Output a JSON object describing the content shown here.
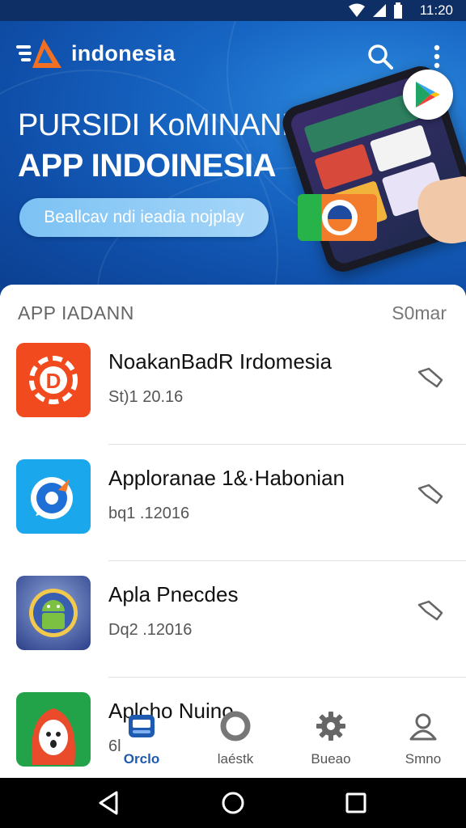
{
  "status_bar": {
    "time": "11:20"
  },
  "header": {
    "brand": "indonesia"
  },
  "hero": {
    "title_line1": "PURSIDI KoMINANN",
    "title_line2": "APP INDOINESIA",
    "cta_label": "Beallcav ndi ieadia nojplay"
  },
  "section": {
    "title": "APP IADANN",
    "more": "S0mar"
  },
  "apps": [
    {
      "name": "NoakanBadR Irdomesia",
      "date": "St)1 20.16",
      "icon": "flame-d-icon"
    },
    {
      "name": "Apploranae 1&·Habonian",
      "date": "bq1 .12016",
      "icon": "chat-bubble-rocket-icon"
    },
    {
      "name": "Apla Pnecdes",
      "date": "Dq2 .12016",
      "icon": "android-robot-icon"
    },
    {
      "name": "Aplcho Nuino",
      "date": "6l",
      "icon": "red-hair-character-icon"
    }
  ],
  "tabs": [
    {
      "label": "Orclo",
      "icon": "device-icon",
      "active": true
    },
    {
      "label": "laéstk",
      "icon": "circle-icon",
      "active": false
    },
    {
      "label": "Bueao",
      "icon": "gear-icon",
      "active": false
    },
    {
      "label": "Smno",
      "icon": "person-icon",
      "active": false
    }
  ],
  "colors": {
    "hero_blue": "#1766c4",
    "accent": "#1e5bb0",
    "status_bar": "#0d2f66"
  }
}
